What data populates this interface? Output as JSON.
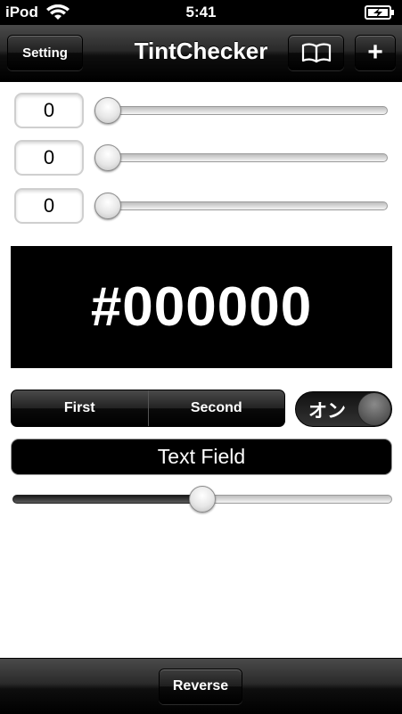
{
  "status_bar": {
    "carrier": "iPod",
    "time": "5:41",
    "wifi_icon": "wifi-icon",
    "battery_icon": "battery-charging-icon"
  },
  "nav_bar": {
    "title": "TintChecker",
    "setting_label": "Setting",
    "book_icon": "book-icon",
    "add_label": "+"
  },
  "rgb_controls": [
    {
      "value": "0",
      "slider_fraction": 0
    },
    {
      "value": "0",
      "slider_fraction": 0
    },
    {
      "value": "0",
      "slider_fraction": 0
    }
  ],
  "preview": {
    "hex": "#000000",
    "color": "#000000"
  },
  "segmented_control": {
    "segments": [
      "First",
      "Second"
    ]
  },
  "switch": {
    "label": "オン",
    "on": true
  },
  "text_field": {
    "value": "Text Field"
  },
  "sample_slider": {
    "fraction": 0.5
  },
  "toolbar": {
    "reverse_label": "Reverse"
  }
}
